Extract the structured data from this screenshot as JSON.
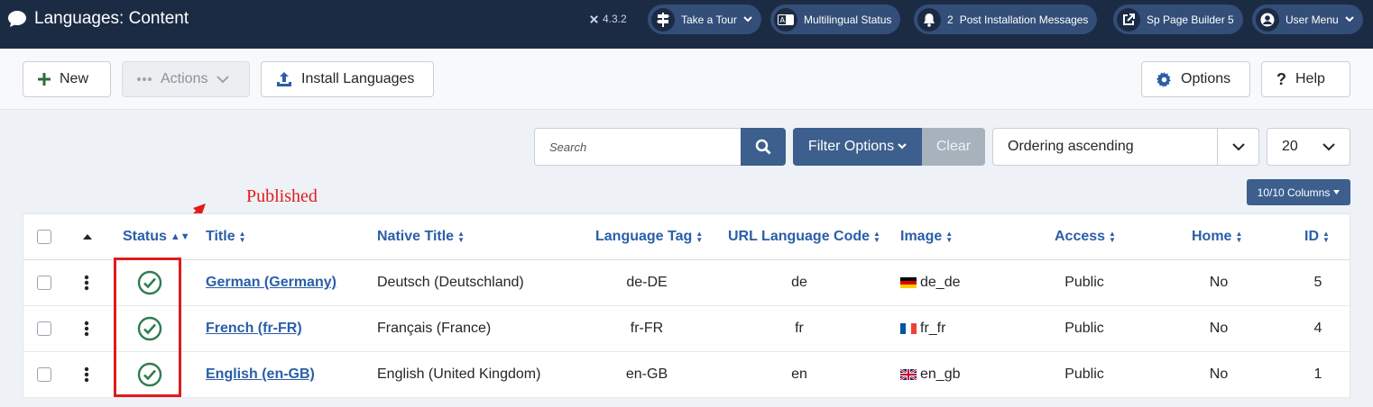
{
  "header": {
    "title": "Languages: Content",
    "version": "4.3.2",
    "pills": [
      {
        "label": "Take a Tour",
        "icon": "signpost-icon"
      },
      {
        "label": "Multilingual Status",
        "icon": "translate-icon"
      },
      {
        "label": "Post Installation Messages",
        "icon": "bell-icon",
        "count": "2"
      },
      {
        "label": "Sp Page Builder 5",
        "icon": "external-link-icon"
      },
      {
        "label": "User Menu",
        "icon": "user-icon"
      }
    ]
  },
  "toolbar": {
    "new_label": "New",
    "actions_label": "Actions",
    "install_label": "Install Languages",
    "options_label": "Options",
    "help_label": "Help"
  },
  "filters": {
    "search_placeholder": "Search",
    "filter_options_label": "Filter Options",
    "clear_label": "Clear",
    "ordering_value": "Ordering ascending",
    "limit_value": "20",
    "columns_label": "10/10 Columns"
  },
  "annotation": {
    "text": "Published",
    "color": "#e01b1b"
  },
  "table": {
    "headers": {
      "status": "Status",
      "title": "Title",
      "native_title": "Native Title",
      "language_tag": "Language Tag",
      "url_code": "URL Language Code",
      "image": "Image",
      "access": "Access",
      "home": "Home",
      "id": "ID"
    },
    "rows": [
      {
        "title": "German (Germany)",
        "native_title": "Deutsch (Deutschland)",
        "language_tag": "de-DE",
        "url_code": "de",
        "image": "de_de",
        "flag": "germany-flag-icon",
        "access": "Public",
        "home": "No",
        "id": "5"
      },
      {
        "title": "French (fr-FR)",
        "native_title": "Français (France)",
        "language_tag": "fr-FR",
        "url_code": "fr",
        "image": "fr_fr",
        "flag": "france-flag-icon",
        "access": "Public",
        "home": "No",
        "id": "4"
      },
      {
        "title": "English (en-GB)",
        "native_title": "English (United Kingdom)",
        "language_tag": "en-GB",
        "url_code": "en",
        "image": "en_gb",
        "flag": "uk-flag-icon",
        "access": "Public",
        "home": "No",
        "id": "1"
      }
    ]
  },
  "colors": {
    "header_bg": "#1c2b44",
    "accent": "#3c5f8d",
    "link": "#2a5ea8",
    "published": "#2e7d4f"
  }
}
